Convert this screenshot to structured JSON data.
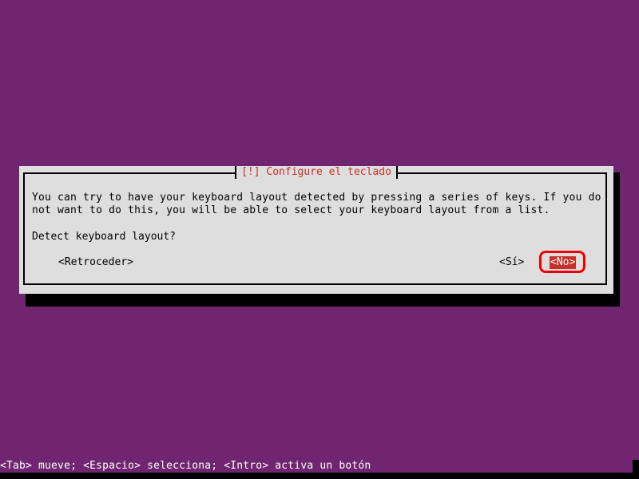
{
  "dialog": {
    "title": "[!] Configure el teclado",
    "message_lines": [
      "You can try to have your keyboard layout detected by pressing a series of keys. If you do",
      "not want to do this, you will be able to select your keyboard layout from a list."
    ],
    "question": "Detect keyboard layout?",
    "buttons": {
      "back": "<Retroceder>",
      "yes": "<Sí>",
      "no": "<No>"
    },
    "selected_button": "no"
  },
  "status_bar": {
    "hint": "<Tab> mueve; <Espacio> selecciona; <Intro> activa un botón"
  },
  "colors": {
    "background": "#6f256f",
    "dialog": "#dedede",
    "accent": "#c8302a",
    "annotation": "#ee0000"
  }
}
